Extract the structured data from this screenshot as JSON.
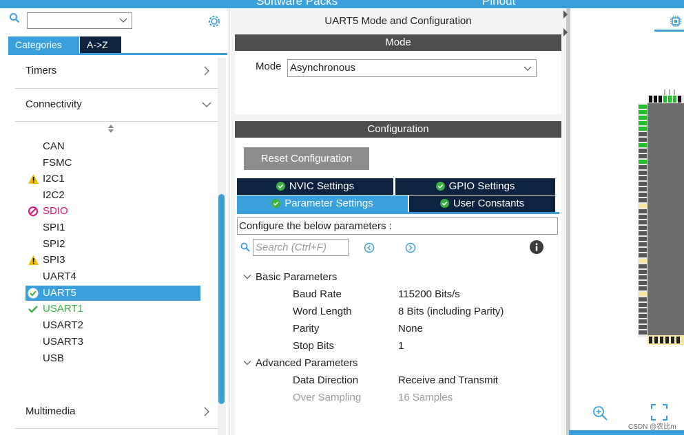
{
  "header": {
    "software_packs": "Software Packs",
    "pinout": "Pinout"
  },
  "left_panel": {
    "search_placeholder": "",
    "tabs": [
      {
        "label": "Categories",
        "active": true
      },
      {
        "label": "A->Z",
        "active": false
      }
    ],
    "categories": [
      {
        "label": "Timers",
        "expanded": false
      },
      {
        "label": "Connectivity",
        "expanded": true
      },
      {
        "label": "Multimedia",
        "expanded": false
      }
    ],
    "peripherals": [
      {
        "label": "CAN",
        "status": "none"
      },
      {
        "label": "FSMC",
        "status": "none"
      },
      {
        "label": "I2C1",
        "status": "warning"
      },
      {
        "label": "I2C2",
        "status": "none"
      },
      {
        "label": "SDIO",
        "status": "blocked"
      },
      {
        "label": "SPI1",
        "status": "none"
      },
      {
        "label": "SPI2",
        "status": "none"
      },
      {
        "label": "SPI3",
        "status": "warning"
      },
      {
        "label": "UART4",
        "status": "none"
      },
      {
        "label": "UART5",
        "status": "selected-ok"
      },
      {
        "label": "USART1",
        "status": "ok"
      },
      {
        "label": "USART2",
        "status": "none"
      },
      {
        "label": "USART3",
        "status": "none"
      },
      {
        "label": "USB",
        "status": "none"
      }
    ]
  },
  "middle_panel": {
    "title": "UART5 Mode and Configuration",
    "mode_bar": "Mode",
    "mode_label": "Mode",
    "mode_value": "Asynchronous",
    "config_bar": "Configuration",
    "reset_button": "Reset Configuration",
    "settings_tabs": {
      "nvic": "NVIC Settings",
      "gpio": "GPIO Settings",
      "parameter": "Parameter Settings",
      "user_constants": "User Constants"
    },
    "configure_hint": "Configure the below parameters :",
    "search_placeholder": "Search (Ctrl+F)",
    "groups": {
      "basic": "Basic Parameters",
      "advanced": "Advanced Parameters"
    },
    "basic_params": [
      {
        "name": "Baud Rate",
        "value": "115200 Bits/s"
      },
      {
        "name": "Word Length",
        "value": "8 Bits (including Parity)"
      },
      {
        "name": "Parity",
        "value": "None"
      },
      {
        "name": "Stop Bits",
        "value": "1"
      }
    ],
    "advanced_params": [
      {
        "name": "Data Direction",
        "value": "Receive and Transmit",
        "enabled": true
      },
      {
        "name": "Over Sampling",
        "value": "16 Samples",
        "enabled": false
      }
    ]
  },
  "right_panel": {
    "watermark": "CSDN @农比m"
  },
  "colors": {
    "accent": "#3aa0dc",
    "navy": "#0d2340",
    "bar_dark": "#4e4e4e",
    "warning": "#f5b800",
    "error": "#d6157b",
    "ok": "#3bb143",
    "pin_green": "#1fbf2a"
  }
}
